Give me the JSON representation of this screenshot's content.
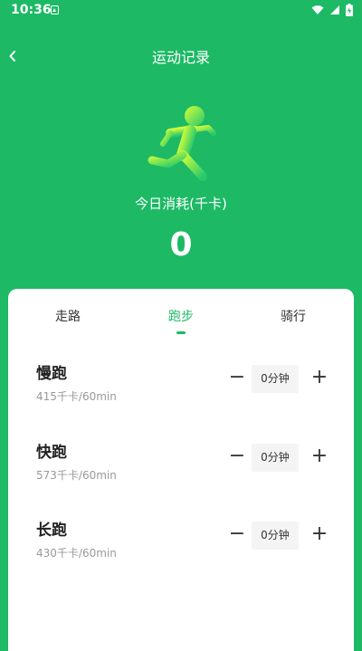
{
  "status_bar": {
    "time": "10:36"
  },
  "header": {
    "title": "运动记录"
  },
  "summary": {
    "label": "今日消耗(千卡)",
    "value": "0"
  },
  "tabs": [
    {
      "label": "走路",
      "active": false
    },
    {
      "label": "跑步",
      "active": true
    },
    {
      "label": "骑行",
      "active": false
    }
  ],
  "items": [
    {
      "name": "慢跑",
      "rate": "415千卡/60min",
      "duration": "0分钟",
      "minus": "−",
      "plus": "+"
    },
    {
      "name": "快跑",
      "rate": "573千卡/60min",
      "duration": "0分钟",
      "minus": "−",
      "plus": "+"
    },
    {
      "name": "长跑",
      "rate": "430千卡/60min",
      "duration": "0分钟",
      "minus": "−",
      "plus": "+"
    }
  ],
  "colors": {
    "accent": "#1db965",
    "background": "#1db965"
  }
}
